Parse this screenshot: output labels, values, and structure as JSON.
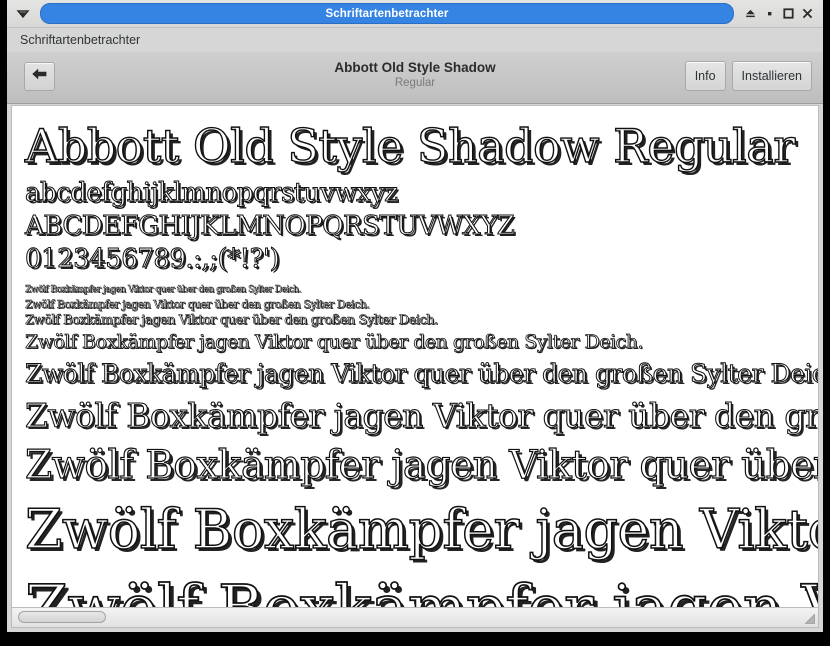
{
  "window": {
    "title": "Schriftartenbetrachter",
    "menu_icon": "window-menu-triangle-icon",
    "controls": [
      {
        "name": "shade-button",
        "icon": "shade-icon",
        "glyph": "≙"
      },
      {
        "name": "minimize-button",
        "icon": "minimize-icon",
        "glyph": "▪"
      },
      {
        "name": "maximize-button",
        "icon": "maximize-icon",
        "glyph": "□"
      },
      {
        "name": "close-button",
        "icon": "close-icon",
        "glyph": "✕"
      }
    ],
    "titlebar_color": "#3584e4",
    "titlebar_text_color": "#ffffff"
  },
  "menubar": {
    "items": [
      {
        "label": "Schriftartenbetrachter"
      }
    ]
  },
  "toolbar": {
    "back_icon": "back-arrow-icon",
    "font_name": "Abbott Old Style Shadow",
    "font_style": "Regular",
    "info_label": "Info",
    "install_label": "Installieren"
  },
  "preview": {
    "title_line": "Abbott Old Style Shadow Regular",
    "lowercase": "abcdefghijklmnopqrstuvwxyz",
    "uppercase": "ABCDEFGHIJKLMNOPQRSTUVWXYZ",
    "digits": "0123456789.:,;(*!?')",
    "pangram": "Zwölf Boxkämpfer jagen Viktor quer über den großen Sylter Deich.",
    "pangram_sizes": [
      8,
      10,
      12,
      18,
      24,
      32,
      38,
      54,
      62
    ],
    "background_color": "#ffffff",
    "text_color": "#111111"
  },
  "scrollbar": {
    "orientation": "horizontal",
    "thumb_position_percent": 0,
    "resize_grip": "resize-grip-icon"
  }
}
